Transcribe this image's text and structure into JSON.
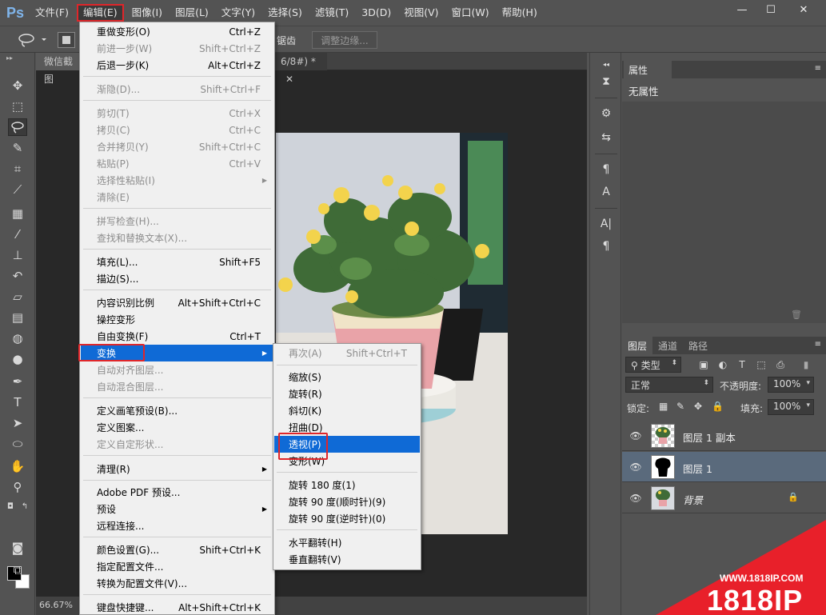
{
  "app": {
    "logo": "Ps",
    "menus": [
      "文件(F)",
      "编辑(E)",
      "图像(I)",
      "图层(L)",
      "文字(Y)",
      "选择(S)",
      "滤镜(T)",
      "3D(D)",
      "视图(V)",
      "窗口(W)",
      "帮助(H)"
    ],
    "active_menu_index": 1
  },
  "options_bar": {
    "antialias_label": "锯齿",
    "refine_edge_label": "调整边缘..."
  },
  "document": {
    "tab1_label": "微信截图",
    "tab2_label": "6/8#) *",
    "zoom": "66.67%"
  },
  "edit_menu": {
    "items": [
      {
        "label": "重做变形(O)",
        "shortcut": "Ctrl+Z",
        "disabled": false
      },
      {
        "label": "前进一步(W)",
        "shortcut": "Shift+Ctrl+Z",
        "disabled": true
      },
      {
        "label": "后退一步(K)",
        "shortcut": "Alt+Ctrl+Z",
        "disabled": false
      },
      {
        "label": "渐隐(D)...",
        "shortcut": "Shift+Ctrl+F",
        "disabled": true
      },
      {
        "label": "剪切(T)",
        "shortcut": "Ctrl+X",
        "disabled": true
      },
      {
        "label": "拷贝(C)",
        "shortcut": "Ctrl+C",
        "disabled": true
      },
      {
        "label": "合并拷贝(Y)",
        "shortcut": "Shift+Ctrl+C",
        "disabled": true
      },
      {
        "label": "粘贴(P)",
        "shortcut": "Ctrl+V",
        "disabled": true
      },
      {
        "label": "选择性粘贴(I)",
        "shortcut": "",
        "disabled": true,
        "submenu": true
      },
      {
        "label": "清除(E)",
        "shortcut": "",
        "disabled": true
      },
      {
        "label": "拼写检查(H)...",
        "shortcut": "",
        "disabled": true
      },
      {
        "label": "查找和替换文本(X)...",
        "shortcut": "",
        "disabled": true
      },
      {
        "label": "填充(L)...",
        "shortcut": "Shift+F5",
        "disabled": false
      },
      {
        "label": "描边(S)...",
        "shortcut": "",
        "disabled": false
      },
      {
        "label": "内容识别比例",
        "shortcut": "Alt+Shift+Ctrl+C",
        "disabled": false
      },
      {
        "label": "操控变形",
        "shortcut": "",
        "disabled": false
      },
      {
        "label": "自由变换(F)",
        "shortcut": "Ctrl+T",
        "disabled": false
      },
      {
        "label": "变换",
        "shortcut": "",
        "disabled": false,
        "submenu": true,
        "highlighted": true
      },
      {
        "label": "自动对齐图层...",
        "shortcut": "",
        "disabled": true
      },
      {
        "label": "自动混合图层...",
        "shortcut": "",
        "disabled": true
      },
      {
        "label": "定义画笔预设(B)...",
        "shortcut": "",
        "disabled": false
      },
      {
        "label": "定义图案...",
        "shortcut": "",
        "disabled": false
      },
      {
        "label": "定义自定形状...",
        "shortcut": "",
        "disabled": true
      },
      {
        "label": "清理(R)",
        "shortcut": "",
        "disabled": false,
        "submenu": true
      },
      {
        "label": "Adobe PDF 预设...",
        "shortcut": "",
        "disabled": false
      },
      {
        "label": "预设",
        "shortcut": "",
        "disabled": false,
        "submenu": true
      },
      {
        "label": "远程连接...",
        "shortcut": "",
        "disabled": false
      },
      {
        "label": "颜色设置(G)...",
        "shortcut": "Shift+Ctrl+K",
        "disabled": false
      },
      {
        "label": "指定配置文件...",
        "shortcut": "",
        "disabled": false
      },
      {
        "label": "转换为配置文件(V)...",
        "shortcut": "",
        "disabled": false
      },
      {
        "label": "键盘快捷键...",
        "shortcut": "Alt+Shift+Ctrl+K",
        "disabled": false
      }
    ]
  },
  "transform_menu": {
    "items": [
      {
        "label": "再次(A)",
        "shortcut": "Shift+Ctrl+T",
        "disabled": true
      },
      {
        "label": "缩放(S)",
        "shortcut": "",
        "disabled": false
      },
      {
        "label": "旋转(R)",
        "shortcut": "",
        "disabled": false
      },
      {
        "label": "斜切(K)",
        "shortcut": "",
        "disabled": false
      },
      {
        "label": "扭曲(D)",
        "shortcut": "",
        "disabled": false
      },
      {
        "label": "透视(P)",
        "shortcut": "",
        "disabled": false,
        "highlighted": true
      },
      {
        "label": "变形(W)",
        "shortcut": "",
        "disabled": false
      },
      {
        "label": "旋转 180 度(1)",
        "shortcut": "",
        "disabled": false
      },
      {
        "label": "旋转 90 度(顺时针)(9)",
        "shortcut": "",
        "disabled": false
      },
      {
        "label": "旋转 90 度(逆时针)(0)",
        "shortcut": "",
        "disabled": false
      },
      {
        "label": "水平翻转(H)",
        "shortcut": "",
        "disabled": false
      },
      {
        "label": "垂直翻转(V)",
        "shortcut": "",
        "disabled": false
      }
    ]
  },
  "properties_panel": {
    "tab_label": "属性",
    "body_text": "无属性"
  },
  "layers_panel": {
    "tabs": [
      "图层",
      "通道",
      "路径"
    ],
    "filter_label": "类型",
    "blend_mode": "正常",
    "opacity_label": "不透明度:",
    "opacity_value": "100%",
    "lock_label": "锁定:",
    "fill_label": "填充:",
    "fill_value": "100%",
    "layers": [
      {
        "name": "图层 1 副本",
        "selected": false,
        "locked": false
      },
      {
        "name": "图层 1",
        "selected": true,
        "locked": false
      },
      {
        "name": "背景",
        "selected": false,
        "locked": true
      }
    ]
  },
  "watermark": {
    "url": "WWW.1818IP.COM",
    "brand": "1818IP"
  },
  "colors": {
    "highlight": "#0f6ad6",
    "annotation_red": "#e0262a",
    "watermark_red": "#e8202a"
  }
}
